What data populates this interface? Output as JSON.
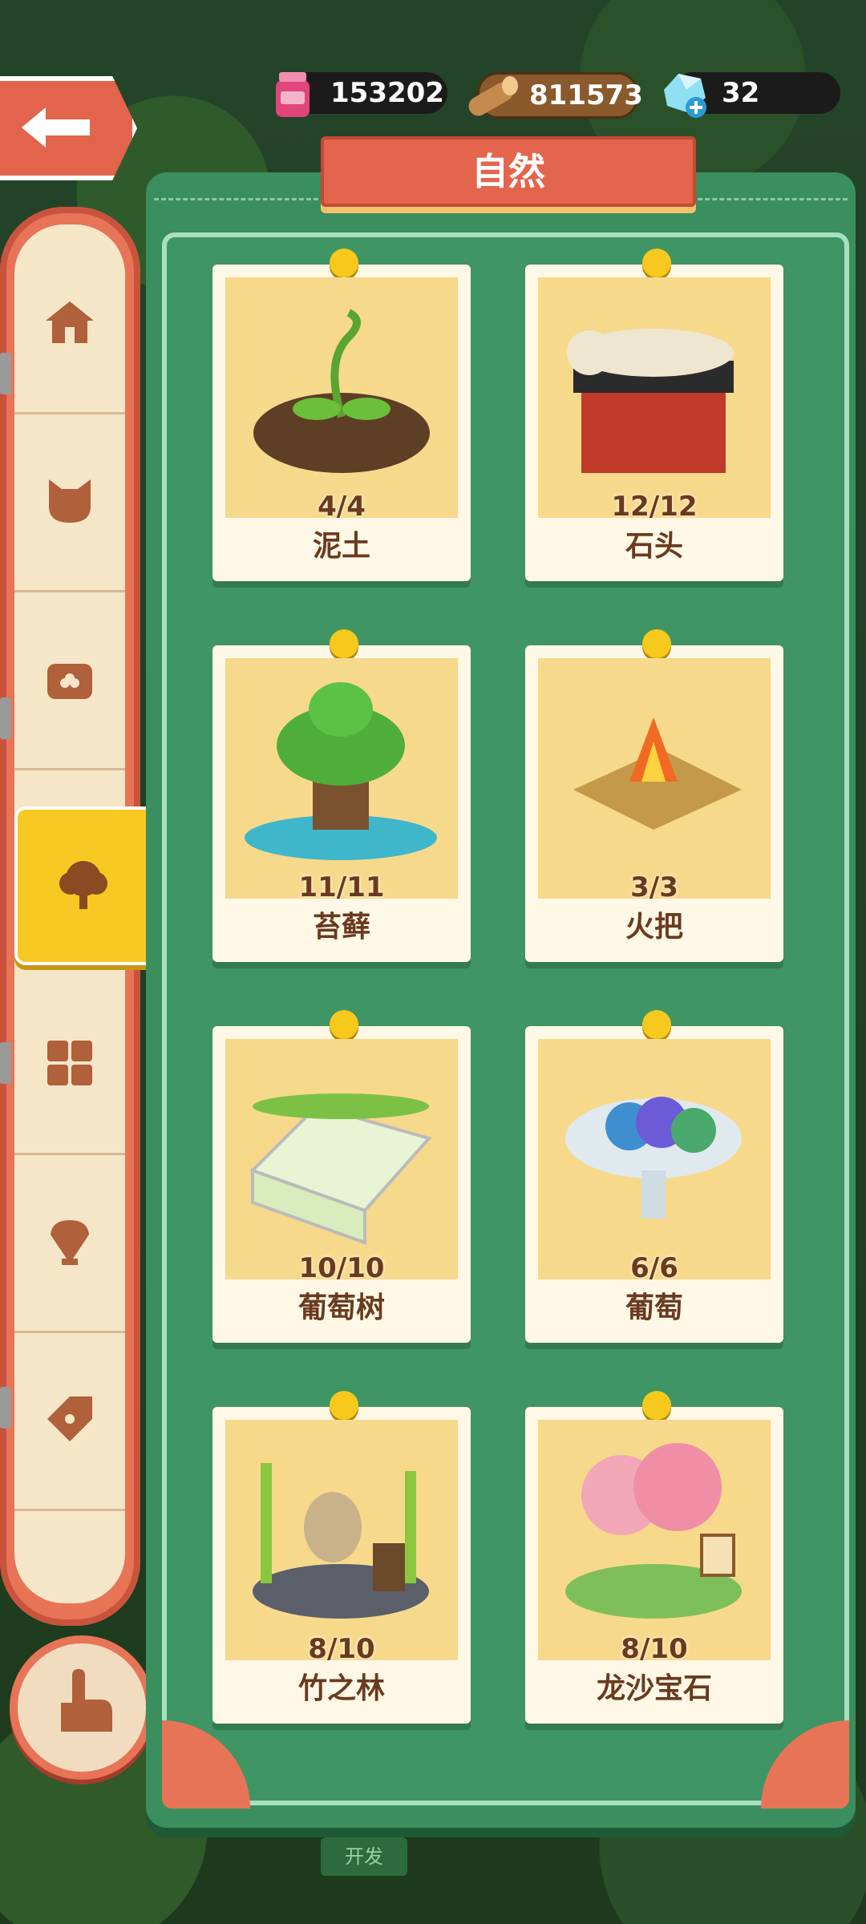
{
  "resources": {
    "jam": {
      "value": "153202",
      "icon": "jam-jar-icon"
    },
    "wood": {
      "value": "811573",
      "icon": "wood-log-icon"
    },
    "gem": {
      "value": "32",
      "icon": "gem-add-icon"
    }
  },
  "title": "自然",
  "sidebar": {
    "tabs": [
      {
        "icon": "house-icon"
      },
      {
        "icon": "cat-head-icon"
      },
      {
        "icon": "treasure-chest-icon"
      },
      {
        "icon": "tree-icon",
        "active": true
      },
      {
        "icon": "grid-icon"
      },
      {
        "icon": "shell-icon"
      },
      {
        "icon": "tag-icon"
      }
    ]
  },
  "cards": [
    {
      "name": "泥土",
      "count": "4/4"
    },
    {
      "name": "石头",
      "count": "12/12"
    },
    {
      "name": "苔藓",
      "count": "11/11"
    },
    {
      "name": "火把",
      "count": "3/3"
    },
    {
      "name": "葡萄树",
      "count": "10/10"
    },
    {
      "name": "葡萄",
      "count": "6/6"
    },
    {
      "name": "竹之林",
      "count": "8/10"
    },
    {
      "name": "龙沙宝石",
      "count": "8/10"
    }
  ],
  "bottom_tab": "开发",
  "colors": {
    "accent": "#e4654d",
    "panel": "#3b8e5d",
    "active_tab": "#f8c823"
  }
}
